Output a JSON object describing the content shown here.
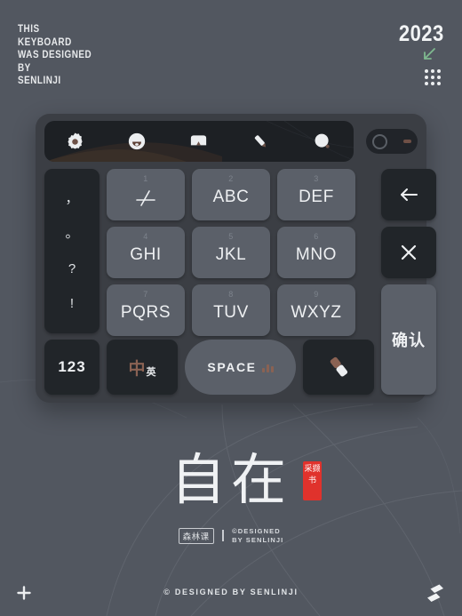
{
  "page": {
    "background_color": "#525760",
    "accent_red": "#e0322c",
    "accent_brown": "#8a6253",
    "accent_green": "#7fb98f"
  },
  "header": {
    "headline_lines": [
      "THIS",
      "KEYBOARD",
      "WAS DESIGNED",
      "BY",
      "SENLINJI"
    ],
    "year": "2023",
    "arrow_icon": "arrow-down-left-icon",
    "grid_icon": "dot-grid-icon"
  },
  "keyboard": {
    "toolbar": {
      "icons": [
        {
          "name": "gear-icon",
          "label": "Settings"
        },
        {
          "name": "emoji-icon",
          "label": "Emoji"
        },
        {
          "name": "keyboard-icon",
          "label": "Keyboard"
        },
        {
          "name": "pencil-icon",
          "label": "Handwriting"
        },
        {
          "name": "voice-icon",
          "label": "Voice"
        }
      ],
      "toggle": {
        "name": "power-toggle",
        "state": "off"
      }
    },
    "punctuation_key": {
      "name": "punctuation-key",
      "glyphs": [
        "，",
        "。",
        "?",
        "!"
      ]
    },
    "number_keys": [
      {
        "num": "1",
        "label": "",
        "glyph": "symbols-icon"
      },
      {
        "num": "2",
        "label": "ABC"
      },
      {
        "num": "3",
        "label": "DEF"
      },
      {
        "num": "4",
        "label": "GHI"
      },
      {
        "num": "5",
        "label": "JKL"
      },
      {
        "num": "6",
        "label": "MNO"
      },
      {
        "num": "7",
        "label": "PQRS"
      },
      {
        "num": "8",
        "label": "TUV"
      },
      {
        "num": "9",
        "label": "WXYZ"
      }
    ],
    "bottom_row": {
      "numeric": "123",
      "lang_cn": "中",
      "lang_en": "英",
      "space": "SPACE",
      "brush_icon": "eraser-icon"
    },
    "function_keys": {
      "backspace_icon": "backspace-arrow-icon",
      "close_icon": "close-x-icon",
      "confirm": "确认"
    }
  },
  "brand": {
    "title": "自在",
    "seal_text": "采撷书",
    "badge": "森林课",
    "credit_line1": "©DESIGNED",
    "credit_line2": "BY SENLINJI"
  },
  "footer": {
    "plus_icon": "plus-icon",
    "text": "© DESIGNED BY SENLINJI",
    "logo_icon": "senlinji-logo-icon"
  }
}
